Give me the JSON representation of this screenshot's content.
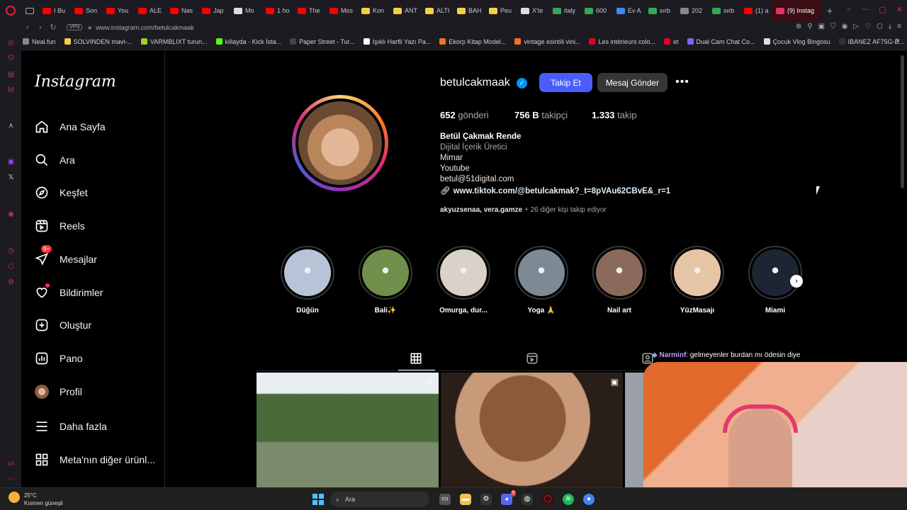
{
  "browser": {
    "tabs": [
      {
        "label": "I Bu",
        "color": "#ff0000"
      },
      {
        "label": "Son",
        "color": "#ff0000"
      },
      {
        "label": "You",
        "color": "#ff0000"
      },
      {
        "label": "ALE",
        "color": "#ff0000"
      },
      {
        "label": "Nas",
        "color": "#ff0000"
      },
      {
        "label": "Jap",
        "color": "#ff0000"
      },
      {
        "label": "Mo",
        "color": "#dddddd"
      },
      {
        "label": "1 ho",
        "color": "#ff0000"
      },
      {
        "label": "The",
        "color": "#ff0000"
      },
      {
        "label": "Mos",
        "color": "#ff0000"
      },
      {
        "label": "Kon",
        "color": "#f4d03f"
      },
      {
        "label": "ANT",
        "color": "#f4d03f"
      },
      {
        "label": "ALTI",
        "color": "#f4d03f"
      },
      {
        "label": "BAH",
        "color": "#f4d03f"
      },
      {
        "label": "Peu",
        "color": "#f4d03f"
      },
      {
        "label": "X'te",
        "color": "#dddddd"
      },
      {
        "label": "italy",
        "color": "#34a853"
      },
      {
        "label": "600",
        "color": "#34a853"
      },
      {
        "label": "Ev A",
        "color": "#4285f4"
      },
      {
        "label": "sırb",
        "color": "#34a853"
      },
      {
        "label": "202",
        "color": "#888888"
      },
      {
        "label": "sırb",
        "color": "#34a853"
      },
      {
        "label": "(1) a",
        "color": "#ff0000"
      }
    ],
    "active_tab": "(9) Instag",
    "new_tab": "+",
    "url": "www.instagram.com/betulcakmaak",
    "vpn": "VPN",
    "bookmarks": [
      {
        "label": "Neal.fun",
        "color": "#888888"
      },
      {
        "label": "SOLVINDEN mavi-...",
        "color": "#f4d03f"
      },
      {
        "label": "VARMBLIXT turun...",
        "color": "#9acd32"
      },
      {
        "label": "killayda - Kick İsta...",
        "color": "#53fc18"
      },
      {
        "label": "Paper Street - Tur...",
        "color": "#444444"
      },
      {
        "label": "Işıklı Harfli Yazı Pa...",
        "color": "#ffffff"
      },
      {
        "label": "Ekorp Kitap Model...",
        "color": "#f57224"
      },
      {
        "label": "vintage esintili vini...",
        "color": "#f57224"
      },
      {
        "label": "Les intérieurs colo...",
        "color": "#e60023"
      },
      {
        "label": "et",
        "color": "#e60023"
      },
      {
        "label": "Dual Cam Chat Co...",
        "color": "#7b68ee"
      },
      {
        "label": "Çocuk Vlog Bingosu",
        "color": "#dddddd"
      },
      {
        "label": "IBANEZ AF75G-B...",
        "color": "#333333"
      }
    ]
  },
  "sidebar": {
    "logo": "Instagram",
    "badge": "9+",
    "items": [
      {
        "label": "Ana Sayfa",
        "icon": "home-icon"
      },
      {
        "label": "Ara",
        "icon": "search-icon"
      },
      {
        "label": "Keşfet",
        "icon": "compass-icon"
      },
      {
        "label": "Reels",
        "icon": "reels-icon"
      },
      {
        "label": "Mesajlar",
        "icon": "messenger-icon"
      },
      {
        "label": "Bildirimler",
        "icon": "heart-icon"
      },
      {
        "label": "Oluştur",
        "icon": "plus-square-icon"
      },
      {
        "label": "Pano",
        "icon": "dashboard-icon"
      },
      {
        "label": "Profil",
        "icon": "avatar"
      },
      {
        "label": "Daha fazla",
        "icon": "menu-icon"
      },
      {
        "label": "Meta'nın diğer ürünl...",
        "icon": "meta-apps-icon"
      }
    ]
  },
  "profile": {
    "username": "betulcakmaak",
    "follow_label": "Takip Et",
    "message_label": "Mesaj Gönder",
    "more_label": "•••",
    "stats": {
      "posts_count": "652",
      "posts_label": "gönderi",
      "followers_count": "756 B",
      "followers_label": "takipçi",
      "following_count": "1.333",
      "following_label": "takip"
    },
    "full_name": "Betül Çakmak Rende",
    "category": "Dijital İçerik Üretici",
    "bio_lines": [
      "Mimar",
      "Youtube",
      "betul@51digital.com"
    ],
    "link": "www.tiktok.com/@betulcakmak?_t=8pVAu62CBvE&_r=1",
    "followed_by_names": "akyuzsenaa, vera.gamze",
    "followed_by_rest": "+ 26 diğer kişi takip ediyor"
  },
  "highlights": [
    {
      "label": "Düğün",
      "color": "#b7c4d8"
    },
    {
      "label": "Bali✨",
      "color": "#6f8f4a"
    },
    {
      "label": "Omurga, dur...",
      "color": "#d8d2c8"
    },
    {
      "label": "Yoga 🙏",
      "color": "#7c8a96"
    },
    {
      "label": "Nail art",
      "color": "#8a6a5a"
    },
    {
      "label": "YüzMasajı",
      "color": "#e6c4a6"
    },
    {
      "label": "Miami",
      "color": "#1d2433"
    }
  ],
  "chat": {
    "user": "Narminf",
    "message": ": gelmeyenler burdan mı ödesin diye"
  },
  "taskbar": {
    "temperature": "25°C",
    "weather": "Kısmen güneşli",
    "search_placeholder": "Ara",
    "notification_badge": "9"
  }
}
